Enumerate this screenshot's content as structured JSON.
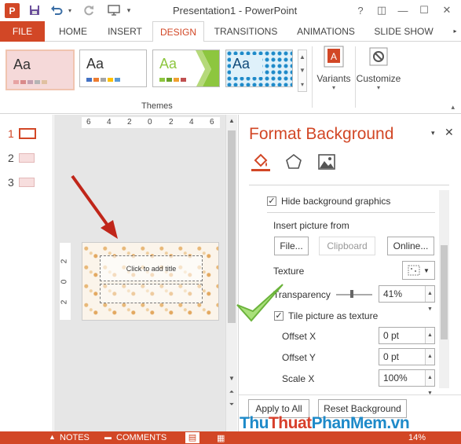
{
  "window": {
    "title": "Presentation1 - PowerPoint",
    "app_logo": "P",
    "controls": [
      "?",
      "◫",
      "—",
      "☐",
      "✕"
    ]
  },
  "qat": {
    "save_icon": "save-icon",
    "undo_icon": "undo-icon",
    "redo_icon": "redo-icon",
    "present_icon": "start-from-beginning-icon"
  },
  "tabs": [
    "FILE",
    "HOME",
    "INSERT",
    "DESIGN",
    "TRANSITIONS",
    "ANIMATIONS",
    "SLIDE SHOW"
  ],
  "active_tab": "DESIGN",
  "ribbon": {
    "themes_label": "Themes",
    "themes": [
      {
        "label": "Aa",
        "bg": "#f5d9d9",
        "accent": "#e7a3a3"
      },
      {
        "label": "Aa",
        "bg": "#ffffff",
        "accent": "#333333"
      },
      {
        "label": "Aa",
        "bg": "#ffffff",
        "accent": "#8dc63f"
      },
      {
        "label": "Aa",
        "bg": "#dff1fa",
        "accent": "#1e8ac9"
      }
    ],
    "variants_label": "Variants",
    "customize_label": "Customize"
  },
  "slides": {
    "numbers": [
      "1",
      "2",
      "3"
    ],
    "selected": "1"
  },
  "ruler": {
    "h_ticks": [
      "6",
      "4",
      "2",
      "0",
      "2",
      "4",
      "6"
    ],
    "v_ticks": [
      "2",
      "0",
      "2"
    ]
  },
  "slide": {
    "title_placeholder": "Click to add title"
  },
  "format_background": {
    "title": "Format Background",
    "pane_tabs": [
      "fill-icon",
      "effects-icon",
      "picture-icon"
    ],
    "hide_background_graphics": "Hide background graphics",
    "insert_picture_from": "Insert picture from",
    "file_button": "File...",
    "clipboard_button": "Clipboard",
    "online_button": "Online...",
    "texture_label": "Texture",
    "transparency_label": "Transparency",
    "transparency_value": "41%",
    "tile_label": "Tile picture as texture",
    "offset_x_label": "Offset X",
    "offset_x_value": "0 pt",
    "offset_y_label": "Offset Y",
    "offset_y_value": "0 pt",
    "scale_x_label": "Scale X",
    "scale_x_value": "100%",
    "apply_all_button": "Apply to All",
    "reset_button": "Reset Background"
  },
  "status": {
    "notes": "NOTES",
    "comments": "COMMENTS",
    "zoom": "14%"
  },
  "watermark": {
    "part1": "Thu",
    "part2": "Thuat",
    "part3": "PhanMem",
    "part4": ".vn"
  }
}
